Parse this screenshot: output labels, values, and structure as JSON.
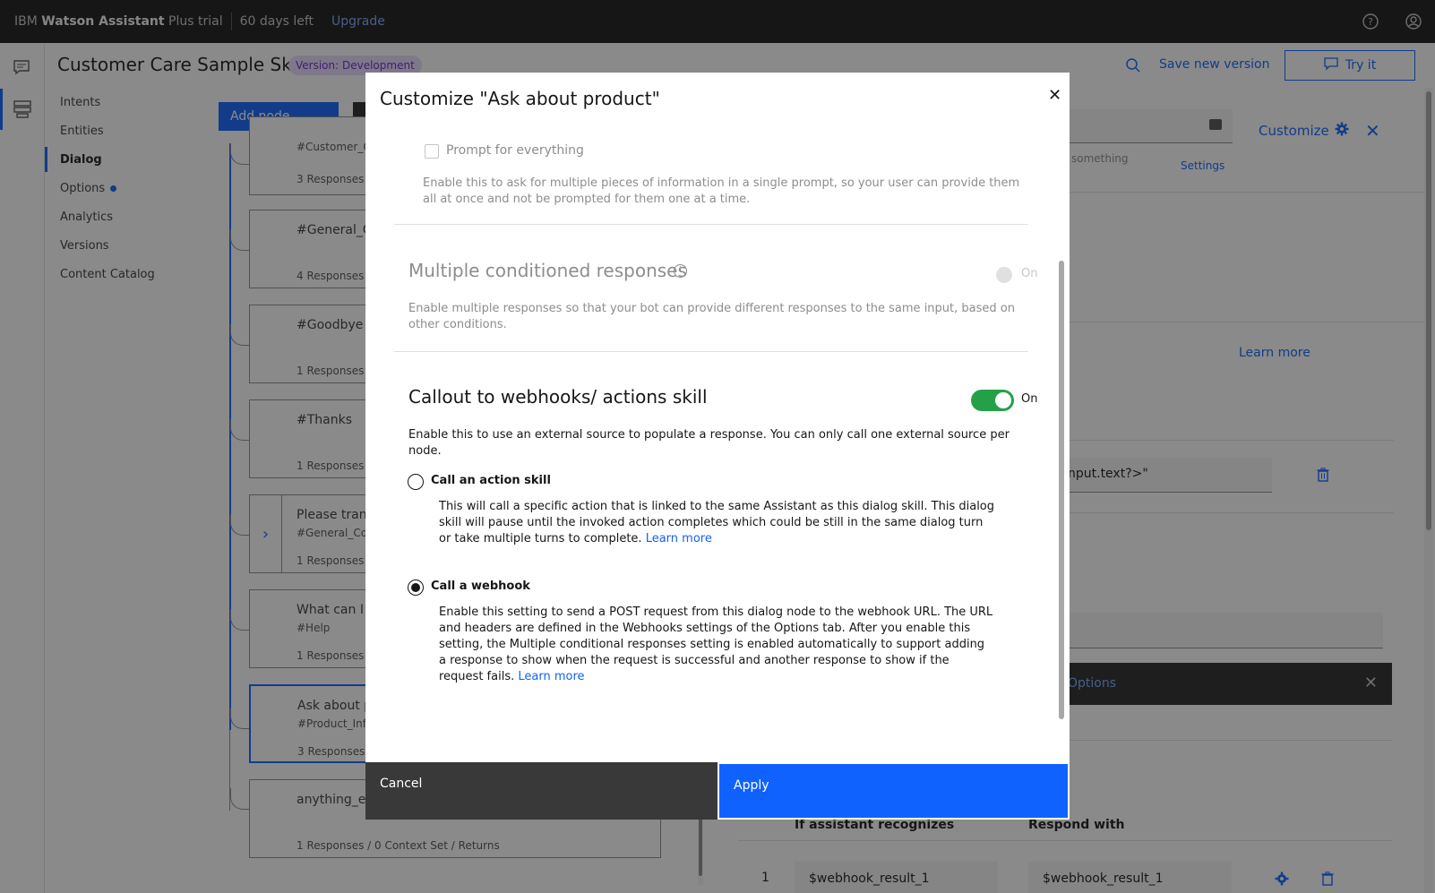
{
  "topbar": {
    "brand_prefix": "IBM",
    "brand_product": "Watson Assistant",
    "brand_suffix": "Plus trial",
    "days_left": "60 days left",
    "upgrade": "Upgrade"
  },
  "header": {
    "skill_title": "Customer Care Sample Skill",
    "version_tag": "Version: Development",
    "save_version": "Save new version",
    "try_it": "Try it"
  },
  "sidenav": {
    "items": [
      {
        "label": "Intents"
      },
      {
        "label": "Entities"
      },
      {
        "label": "Dialog"
      },
      {
        "label": "Options"
      },
      {
        "label": "Analytics"
      },
      {
        "label": "Versions"
      },
      {
        "label": "Content Catalog"
      }
    ]
  },
  "tree": {
    "add_node": "Add node",
    "nodes": [
      {
        "title": "",
        "condition": "#Customer_C",
        "meta": "3 Responses /"
      },
      {
        "title": "#General_G",
        "condition": "",
        "meta": "4 Responses /"
      },
      {
        "title": "#Goodbye",
        "condition": "",
        "meta": "1 Responses /"
      },
      {
        "title": "#Thanks",
        "condition": "",
        "meta": "1 Responses /"
      },
      {
        "title": "Please trans",
        "condition": "#General_Co",
        "meta": "1 Responses /"
      },
      {
        "title": "What can I d",
        "condition": "#Help",
        "meta": "1 Responses /"
      },
      {
        "title": "Ask about p",
        "condition": "#Product_Inf",
        "meta": "3 Responses"
      },
      {
        "title": "anything_els",
        "condition": "",
        "meta": "1 Responses / 0 Context Set / Returns"
      }
    ]
  },
  "right_panel": {
    "customize": "Customize",
    "something": "something",
    "settings": "Settings",
    "learn_more": "Learn more",
    "input_value": "nput.text?>\"",
    "notice_text": "Options",
    "col_if": "If assistant recognizes",
    "col_respond": "Respond with",
    "row_num": "1",
    "row_if": "$webhook_result_1",
    "row_respond": "$webhook_result_1"
  },
  "modal": {
    "title": "Customize \"Ask about product\"",
    "prompt_checkbox": "Prompt for everything",
    "prompt_desc": "Enable this to ask for multiple pieces of information in a single prompt, so your user can provide them all at once and not be prompted for them one at a time.",
    "mcr_title": "Multiple conditioned responses",
    "mcr_toggle": "On",
    "mcr_desc": "Enable multiple responses so that your bot can provide different responses to the same input, based on other conditions.",
    "callout_title": "Callout to webhooks/ actions skill",
    "callout_toggle": "On",
    "callout_desc": "Enable this to use an external source to populate a response. You can only call one external source per node.",
    "action_label": "Call an action skill",
    "action_desc": "This will call a specific action that is linked to the same Assistant as this dialog skill. This dialog skill will pause until the invoked action completes which could be still in the same dialog turn or take multiple turns to complete.",
    "webhook_label": "Call a webhook",
    "webhook_desc": "Enable this setting to send a POST request from this dialog node to the webhook URL. The URL and headers are defined in the Webhooks settings of the Options tab. After you enable this setting, the Multiple conditional responses setting is enabled automatically to support adding a response to show when the request is successful and another response to show if the request fails.",
    "learn_more": "Learn more",
    "cancel": "Cancel",
    "apply": "Apply"
  },
  "colors": {
    "brand_blue": "#0f62fe",
    "toggle_green": "#24a148",
    "topbar_bg": "#161616"
  }
}
